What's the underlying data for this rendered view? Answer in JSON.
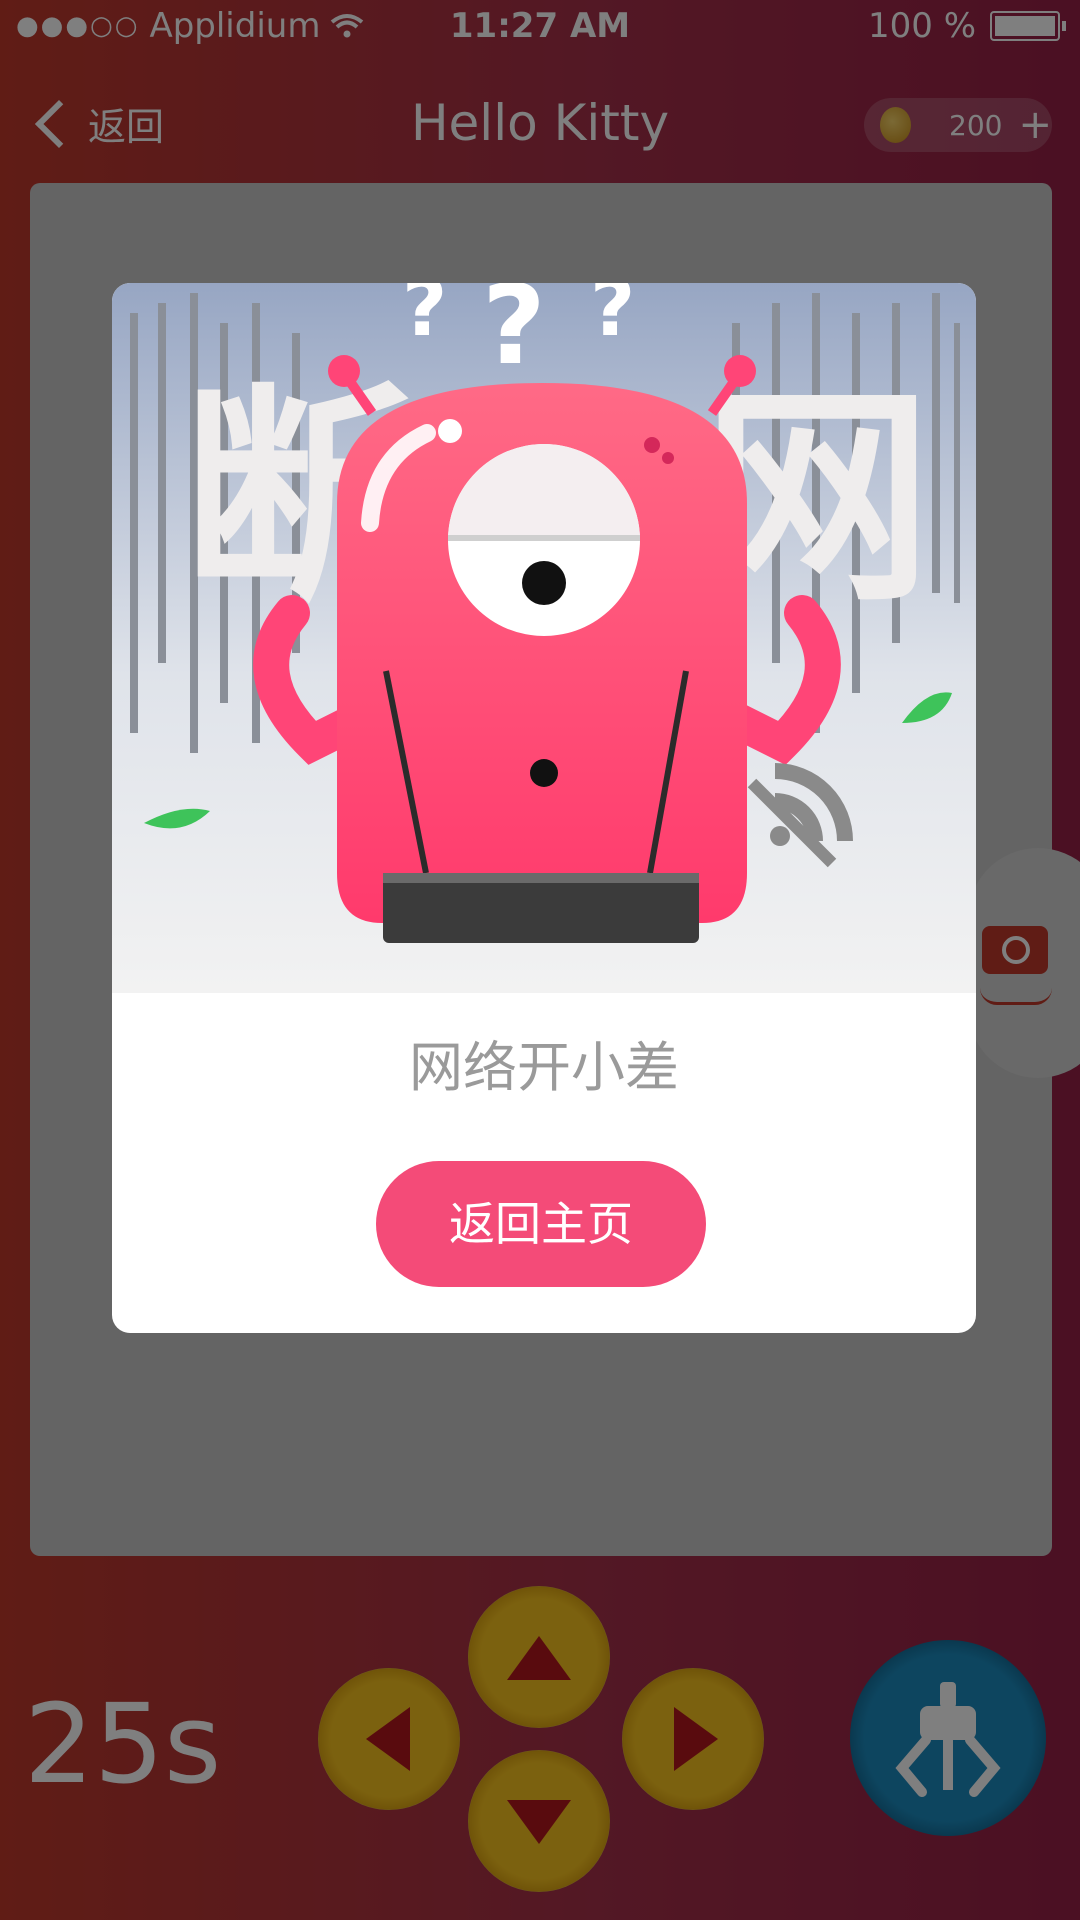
{
  "status_bar": {
    "carrier": "Applidium",
    "signal_dots": "●●●○○",
    "time": "11:27 AM",
    "battery": "100 %",
    "wifi_icon": "wifi-icon"
  },
  "nav": {
    "back_label": "返回",
    "title": "Hello Kitty",
    "coins": "200",
    "add_label": "+"
  },
  "timer": "25s",
  "modal": {
    "illustration_text": "断网",
    "question_marks": "???",
    "message": "网络开小差",
    "button_label": "返回主页"
  },
  "colors": {
    "accent": "#f44b78",
    "monster": "#ff4c77",
    "background_start": "#c0392b",
    "background_end": "#962046",
    "dpad": "#f7c21e",
    "grab": "#1b8bbf"
  },
  "icons": {
    "camera": "camera-switch-icon",
    "grab": "claw-icon",
    "coin": "coin-icon"
  }
}
